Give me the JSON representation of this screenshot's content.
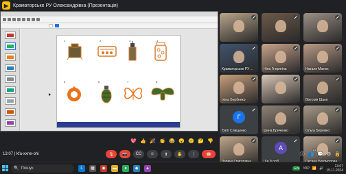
{
  "presenter": {
    "title": "Краматорське РУ Олександрівка (Презентація)"
  },
  "meeting": {
    "time": "13:07",
    "code": "kfa-xxne-ohi"
  },
  "slide_numbers": [
    "1",
    "2",
    "3",
    "4",
    "5",
    "6",
    "7",
    "8"
  ],
  "participants": [
    {
      "name": "",
      "type": "video",
      "bg": "#b8a58a"
    },
    {
      "name": "",
      "type": "video",
      "bg": "#6d5a4a"
    },
    {
      "name": "",
      "type": "video",
      "bg": "#9c8f84"
    },
    {
      "name": "Краматорське РУ ...",
      "type": "video",
      "bg": "#41536d"
    },
    {
      "name": "Ніна Гнерягіна",
      "type": "video",
      "bg": "#c9a38a"
    },
    {
      "name": "Наталя Матюх",
      "type": "video",
      "bg": "#b89a86"
    },
    {
      "name": "Іліна Бербенко",
      "type": "video",
      "bg": "#c7a07c"
    },
    {
      "name": "",
      "type": "video",
      "bg": "#d9c6b5"
    },
    {
      "name": "Вікторія Шаоп",
      "type": "video",
      "bg": "#7a6d63"
    },
    {
      "name": "Євгії Слищенко",
      "type": "avatar",
      "letter": "Г",
      "color": "#1a73e8"
    },
    {
      "name": "Ірина Бриченко",
      "type": "video",
      "bg": "#8f8275"
    },
    {
      "name": "Ольга Бережко",
      "type": "video",
      "bg": "#a79a88"
    },
    {
      "name": "Зарина Григорівна",
      "type": "video",
      "bg": "#c0a78a"
    },
    {
      "name": "Ще 9 осіб",
      "type": "avatar",
      "letter": "А",
      "color": "#5f4bb6"
    },
    {
      "name": "Оксана Богомолова",
      "type": "video",
      "bg": "#b9a592"
    }
  ],
  "reactions": [
    "💖",
    "👍",
    "🎉",
    "👏",
    "😂",
    "😮",
    "😢",
    "🤔",
    "👎"
  ],
  "controls": {
    "hand_count": "21"
  },
  "taskbar": {
    "search_label": "Пошук",
    "tray_label": "EN",
    "lang": "УКР",
    "clock_time": "13:07",
    "clock_date": "15.11.2024"
  },
  "colors": {
    "accent": "#1a73e8",
    "end_call": "#ea4335",
    "slide_footer": "#2c3e8f"
  }
}
